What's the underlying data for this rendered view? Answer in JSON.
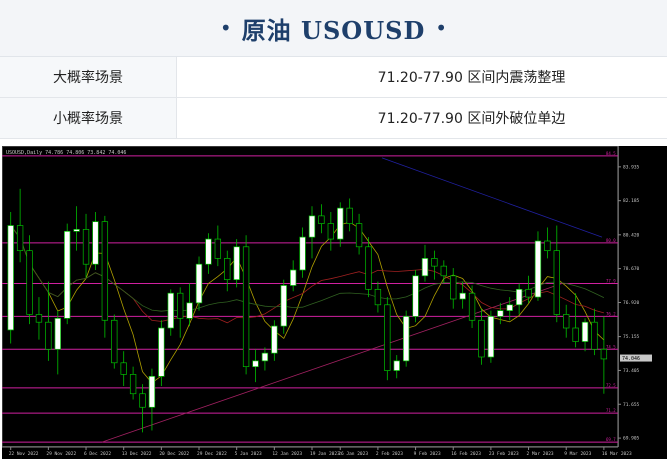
{
  "header": {
    "dot_left": "•",
    "title": "原油 USOUSD",
    "dot_right": "•"
  },
  "scenarios": [
    {
      "label": "大概率场景",
      "value": "71.20-77.90 区间内震荡整理"
    },
    {
      "label": "小概率场景",
      "value": "71.20-77.90 区间外破位单边"
    }
  ],
  "chart": {
    "info_text": "USOUSD,Daily  74.786 74.806 73.842 74.046",
    "current_price": "74.046",
    "colors": {
      "background": "#000000",
      "bull_candle": "#ffffff",
      "bear_candle": "#000000",
      "candle_outline": "#00c000",
      "level_line": "#d020a0",
      "ma_fast": "#b0a000",
      "ma_mid": "#a02020",
      "ma_slow": "#306020",
      "ma_long": "#2020a0"
    },
    "y_ticks": [
      "83.935",
      "82.185",
      "80.420",
      "78.670",
      "76.920",
      "75.155",
      "73.405",
      "71.655",
      "69.905"
    ],
    "level_labels": [
      "84.5",
      "80.0",
      "77.9",
      "76.2",
      "74.5",
      "72.5",
      "71.2",
      "69.7"
    ],
    "x_ticks": [
      "22 Nov 2022",
      "29 Nov 2022",
      "6 Dec 2022",
      "13 Dec 2022",
      "20 Dec 2022",
      "29 Dec 2022",
      "5 Jan 2023",
      "12 Jan 2023",
      "19 Jan 2023",
      "26 Jan 2023",
      "2 Feb 2023",
      "9 Feb 2023",
      "16 Feb 2023",
      "23 Feb 2023",
      "2 Mar 2023",
      "9 Mar 2023",
      "16 Mar 2023"
    ]
  },
  "chart_data": {
    "type": "candlestick",
    "symbol": "USOUSD",
    "timeframe": "Daily",
    "y_range": [
      69.6,
      84.6
    ],
    "levels": [
      84.5,
      80.0,
      77.9,
      76.2,
      74.5,
      72.5,
      71.2,
      69.7
    ],
    "candles": [
      {
        "o": 75.5,
        "h": 81.6,
        "l": 74.8,
        "c": 80.9
      },
      {
        "o": 80.9,
        "h": 82.8,
        "l": 79.0,
        "c": 79.6
      },
      {
        "o": 79.6,
        "h": 80.4,
        "l": 75.8,
        "c": 76.3
      },
      {
        "o": 76.3,
        "h": 77.2,
        "l": 75.0,
        "c": 75.9
      },
      {
        "o": 75.9,
        "h": 78.0,
        "l": 73.9,
        "c": 74.5
      },
      {
        "o": 74.5,
        "h": 76.5,
        "l": 73.2,
        "c": 76.1
      },
      {
        "o": 76.1,
        "h": 81.0,
        "l": 75.8,
        "c": 80.6
      },
      {
        "o": 80.6,
        "h": 81.9,
        "l": 79.6,
        "c": 80.7
      },
      {
        "o": 80.7,
        "h": 81.5,
        "l": 78.2,
        "c": 78.9
      },
      {
        "o": 78.9,
        "h": 81.6,
        "l": 78.6,
        "c": 81.1
      },
      {
        "o": 81.1,
        "h": 81.4,
        "l": 75.1,
        "c": 76.0
      },
      {
        "o": 76.0,
        "h": 76.3,
        "l": 73.5,
        "c": 73.8
      },
      {
        "o": 73.8,
        "h": 74.4,
        "l": 72.6,
        "c": 73.2
      },
      {
        "o": 73.2,
        "h": 73.6,
        "l": 71.9,
        "c": 72.2
      },
      {
        "o": 72.2,
        "h": 72.7,
        "l": 70.2,
        "c": 71.5
      },
      {
        "o": 71.5,
        "h": 73.5,
        "l": 70.3,
        "c": 73.1
      },
      {
        "o": 73.1,
        "h": 76.0,
        "l": 72.6,
        "c": 75.6
      },
      {
        "o": 75.6,
        "h": 77.6,
        "l": 75.2,
        "c": 77.4
      },
      {
        "o": 77.4,
        "h": 77.7,
        "l": 75.1,
        "c": 76.1
      },
      {
        "o": 76.1,
        "h": 77.9,
        "l": 75.7,
        "c": 76.9
      },
      {
        "o": 76.9,
        "h": 79.3,
        "l": 76.5,
        "c": 78.9
      },
      {
        "o": 78.9,
        "h": 80.5,
        "l": 78.4,
        "c": 80.2
      },
      {
        "o": 80.2,
        "h": 80.9,
        "l": 78.8,
        "c": 79.2
      },
      {
        "o": 79.2,
        "h": 79.6,
        "l": 77.5,
        "c": 78.1
      },
      {
        "o": 78.1,
        "h": 80.2,
        "l": 77.7,
        "c": 79.8
      },
      {
        "o": 79.8,
        "h": 80.4,
        "l": 73.2,
        "c": 73.6
      },
      {
        "o": 73.6,
        "h": 74.5,
        "l": 72.8,
        "c": 73.9
      },
      {
        "o": 73.9,
        "h": 74.6,
        "l": 73.4,
        "c": 74.3
      },
      {
        "o": 74.3,
        "h": 76.0,
        "l": 73.9,
        "c": 75.7
      },
      {
        "o": 75.7,
        "h": 78.1,
        "l": 75.3,
        "c": 77.8
      },
      {
        "o": 77.8,
        "h": 79.1,
        "l": 77.5,
        "c": 78.6
      },
      {
        "o": 78.6,
        "h": 80.8,
        "l": 78.2,
        "c": 80.3
      },
      {
        "o": 80.3,
        "h": 81.9,
        "l": 79.2,
        "c": 81.4
      },
      {
        "o": 81.4,
        "h": 82.0,
        "l": 80.5,
        "c": 81.0
      },
      {
        "o": 81.0,
        "h": 81.6,
        "l": 79.6,
        "c": 80.2
      },
      {
        "o": 80.2,
        "h": 82.1,
        "l": 79.8,
        "c": 81.8
      },
      {
        "o": 81.8,
        "h": 82.3,
        "l": 80.6,
        "c": 81.0
      },
      {
        "o": 81.0,
        "h": 81.5,
        "l": 79.4,
        "c": 79.8
      },
      {
        "o": 79.8,
        "h": 80.3,
        "l": 77.2,
        "c": 77.6
      },
      {
        "o": 77.6,
        "h": 78.0,
        "l": 76.4,
        "c": 76.8
      },
      {
        "o": 76.8,
        "h": 77.2,
        "l": 72.9,
        "c": 73.4
      },
      {
        "o": 73.4,
        "h": 74.2,
        "l": 73.0,
        "c": 73.9
      },
      {
        "o": 73.9,
        "h": 76.5,
        "l": 73.6,
        "c": 76.2
      },
      {
        "o": 76.2,
        "h": 78.6,
        "l": 75.9,
        "c": 78.3
      },
      {
        "o": 78.3,
        "h": 79.9,
        "l": 78.0,
        "c": 79.2
      },
      {
        "o": 79.2,
        "h": 79.6,
        "l": 78.1,
        "c": 78.8
      },
      {
        "o": 78.8,
        "h": 79.1,
        "l": 77.9,
        "c": 78.3
      },
      {
        "o": 78.3,
        "h": 78.7,
        "l": 76.6,
        "c": 77.1
      },
      {
        "o": 77.1,
        "h": 78.0,
        "l": 76.6,
        "c": 77.4
      },
      {
        "o": 77.4,
        "h": 77.8,
        "l": 75.6,
        "c": 76.0
      },
      {
        "o": 76.0,
        "h": 76.6,
        "l": 73.7,
        "c": 74.1
      },
      {
        "o": 74.1,
        "h": 76.5,
        "l": 73.8,
        "c": 76.2
      },
      {
        "o": 76.2,
        "h": 76.9,
        "l": 75.8,
        "c": 76.5
      },
      {
        "o": 76.5,
        "h": 77.2,
        "l": 76.0,
        "c": 76.8
      },
      {
        "o": 76.8,
        "h": 77.9,
        "l": 76.3,
        "c": 77.6
      },
      {
        "o": 77.6,
        "h": 78.3,
        "l": 76.9,
        "c": 77.2
      },
      {
        "o": 77.2,
        "h": 80.6,
        "l": 77.0,
        "c": 80.1
      },
      {
        "o": 80.1,
        "h": 80.8,
        "l": 79.2,
        "c": 79.6
      },
      {
        "o": 79.6,
        "h": 80.9,
        "l": 75.9,
        "c": 76.3
      },
      {
        "o": 76.3,
        "h": 76.8,
        "l": 75.1,
        "c": 75.6
      },
      {
        "o": 75.6,
        "h": 77.4,
        "l": 74.6,
        "c": 74.9
      },
      {
        "o": 74.9,
        "h": 76.1,
        "l": 74.4,
        "c": 75.9
      },
      {
        "o": 75.9,
        "h": 76.6,
        "l": 74.2,
        "c": 74.5
      },
      {
        "o": 74.5,
        "h": 76.2,
        "l": 72.2,
        "c": 74.0
      }
    ]
  }
}
